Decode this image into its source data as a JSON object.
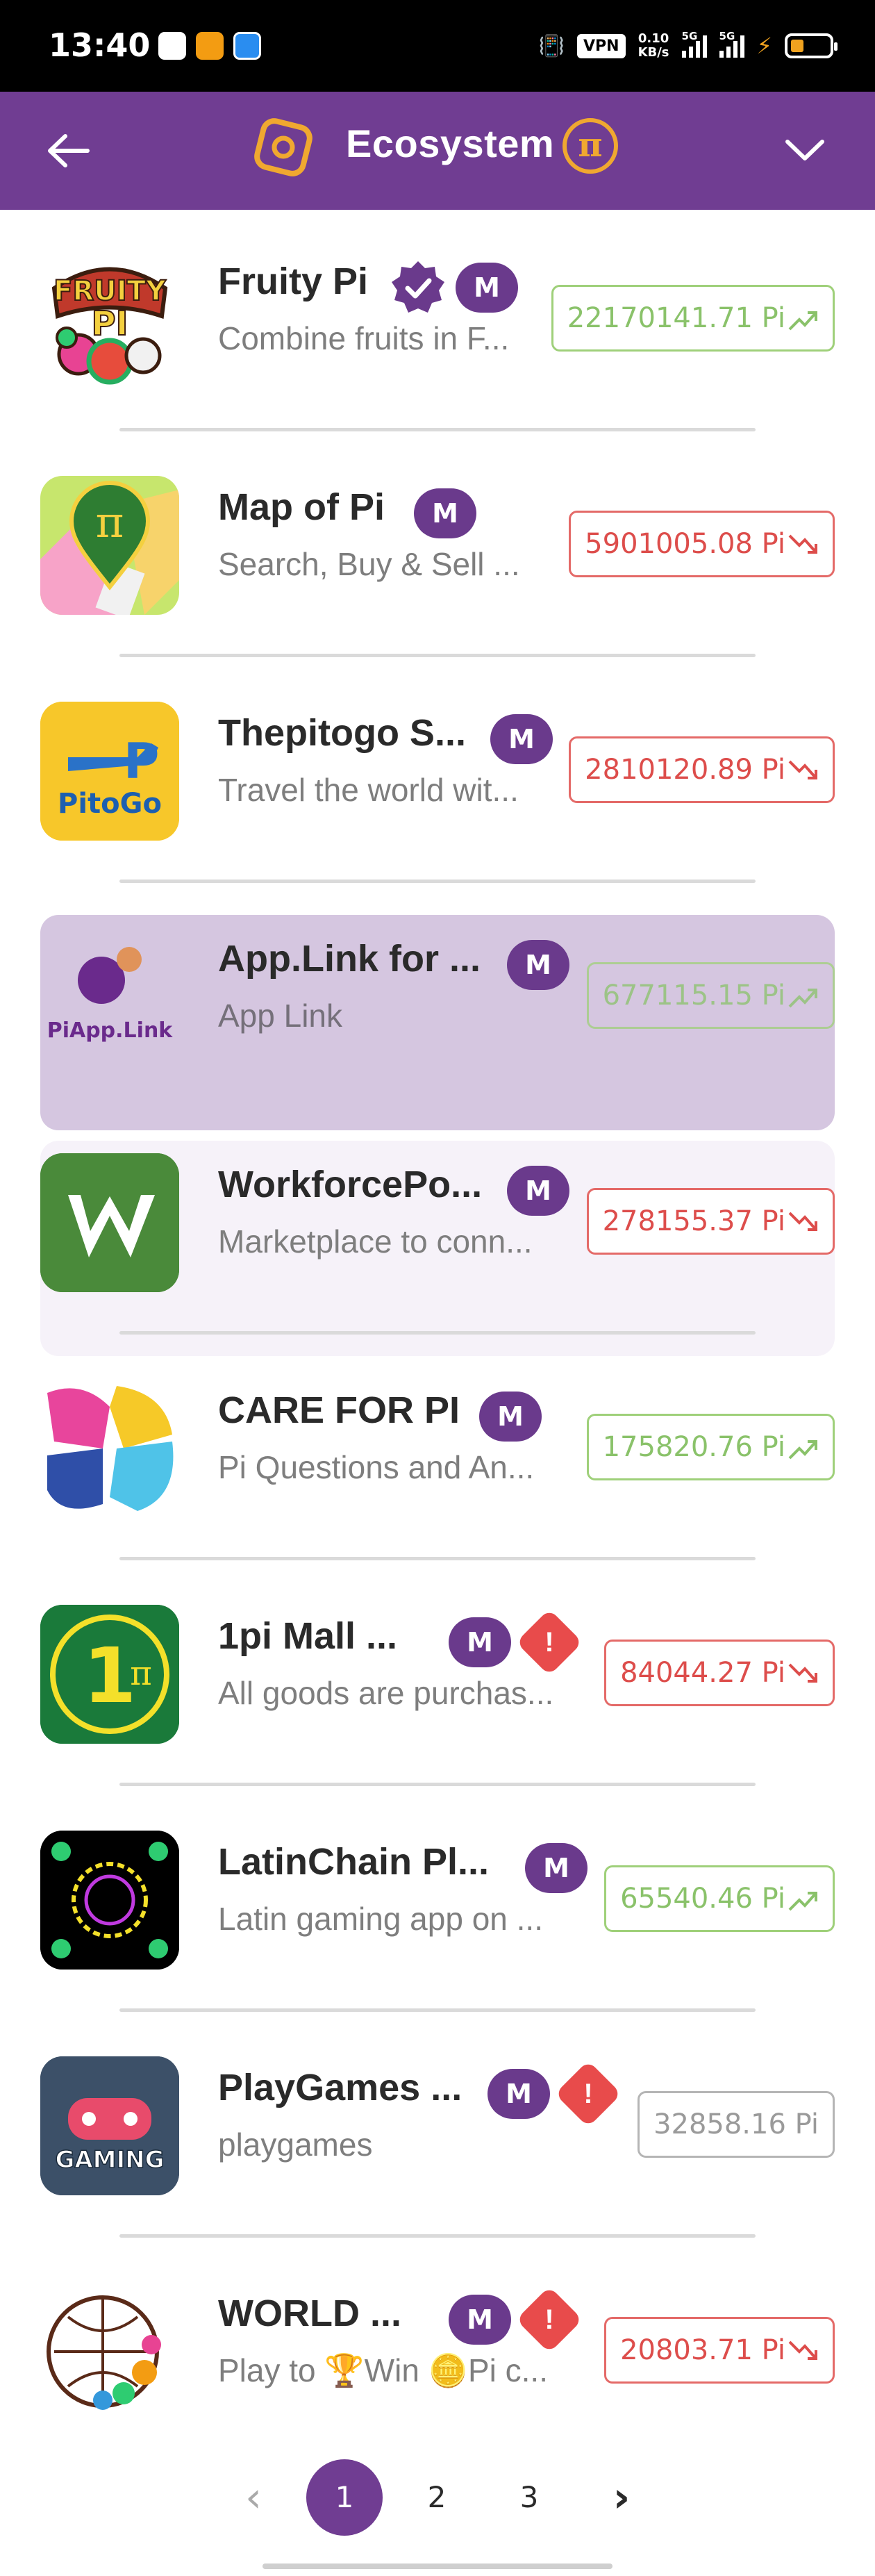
{
  "status_bar": {
    "time": "13:40",
    "vpn": "VPN",
    "speed_value": "0.10",
    "speed_unit": "KB/s",
    "network_1": "5G",
    "network_2": "5G"
  },
  "header": {
    "title": "Ecosystem",
    "accent_color": "#703d92",
    "coin_glyph": "π"
  },
  "apps": [
    {
      "name": "Fruity Pi",
      "description": "Combine fruits in F...",
      "badge": "M",
      "verified": true,
      "warning": false,
      "price": "22170141.71 Pi",
      "trend": "up",
      "highlight": "none",
      "icon": "fruity-pi-logo"
    },
    {
      "name": "Map of Pi",
      "description": "Search, Buy & Sell ...",
      "badge": "M",
      "verified": false,
      "warning": false,
      "price": "5901005.08 Pi",
      "trend": "down",
      "highlight": "none",
      "icon": "map-of-pi-logo"
    },
    {
      "name": "Thepitogo S...",
      "description": "Travel the world wit...",
      "badge": "M",
      "verified": false,
      "warning": false,
      "price": "2810120.89 Pi",
      "trend": "down",
      "highlight": "none",
      "icon": "pitogo-logo",
      "icon_text": "PitoGo"
    },
    {
      "name": "App.Link for ...",
      "description": "App Link",
      "badge": "M",
      "verified": false,
      "warning": false,
      "price": "677115.15 Pi",
      "trend": "up",
      "highlight": "selected",
      "icon": "piapp-link-logo",
      "icon_text": "PiApp.Link"
    },
    {
      "name": "WorkforcePo...",
      "description": "Marketplace to conn...",
      "badge": "M",
      "verified": false,
      "warning": false,
      "price": "278155.37 Pi",
      "trend": "down",
      "highlight": "soft",
      "icon": "workforce-logo"
    },
    {
      "name": "CARE FOR PI",
      "description": "Pi Questions and An...",
      "badge": "M",
      "verified": false,
      "warning": false,
      "price": "175820.76 Pi",
      "trend": "up",
      "highlight": "none",
      "icon": "care-for-pi-logo"
    },
    {
      "name": "1pi Mall ...",
      "description": "All goods are purchas...",
      "badge": "M",
      "verified": false,
      "warning": true,
      "price": "84044.27 Pi",
      "trend": "down",
      "highlight": "none",
      "icon": "1pi-mall-logo"
    },
    {
      "name": "LatinChain Pl...",
      "description": "Latin gaming app on ...",
      "badge": "M",
      "verified": false,
      "warning": false,
      "price": "65540.46 Pi",
      "trend": "up",
      "highlight": "none",
      "icon": "latinchain-logo"
    },
    {
      "name": "PlayGames ...",
      "description": "playgames",
      "badge": "M",
      "verified": false,
      "warning": true,
      "price": "32858.16 Pi",
      "trend": "flat",
      "highlight": "none",
      "icon": "gaming-logo",
      "icon_text": "GAMING"
    },
    {
      "name": "WORLD ...",
      "description": "Play to 🏆Win 🪙Pi c...",
      "badge": "M",
      "verified": false,
      "warning": true,
      "price": "20803.71 Pi",
      "trend": "down",
      "highlight": "none",
      "icon": "world-logo"
    }
  ],
  "pagination": {
    "prev": "‹",
    "pages": [
      "1",
      "2",
      "3"
    ],
    "current": "1",
    "next": "›"
  },
  "warning_glyph": "!"
}
